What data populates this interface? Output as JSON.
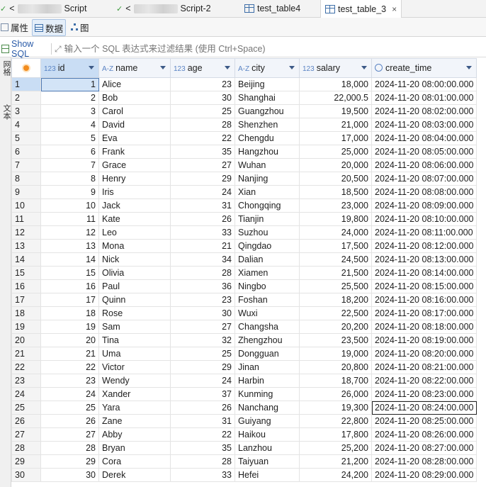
{
  "tabs": [
    {
      "label": "Script",
      "prefix": "<"
    },
    {
      "label": "Script-2",
      "prefix": "<"
    },
    {
      "label": "test_table4"
    },
    {
      "label": "test_table_3",
      "close": "×"
    }
  ],
  "subtabs": [
    "属性",
    "数据",
    "图"
  ],
  "filter": {
    "show_sql": "Show SQL",
    "placeholder": "输入一个 SQL 表达式来过滤结果 (使用 Ctrl+Space)"
  },
  "left_strip": [
    "网格",
    "文本"
  ],
  "columns": [
    {
      "name": "id",
      "type": "123"
    },
    {
      "name": "name",
      "type": "A-Z"
    },
    {
      "name": "age",
      "type": "123"
    },
    {
      "name": "city",
      "type": "A-Z"
    },
    {
      "name": "salary",
      "type": "123"
    },
    {
      "name": "create_time",
      "type": "clock"
    }
  ],
  "rows": [
    [
      "1",
      "1",
      "Alice",
      "23",
      "Beijing",
      "18,000",
      "2024-11-20 08:00:00.000"
    ],
    [
      "2",
      "2",
      "Bob",
      "30",
      "Shanghai",
      "22,000.5",
      "2024-11-20 08:01:00.000"
    ],
    [
      "3",
      "3",
      "Carol",
      "25",
      "Guangzhou",
      "19,500",
      "2024-11-20 08:02:00.000"
    ],
    [
      "4",
      "4",
      "David",
      "28",
      "Shenzhen",
      "21,000",
      "2024-11-20 08:03:00.000"
    ],
    [
      "5",
      "5",
      "Eva",
      "22",
      "Chengdu",
      "17,000",
      "2024-11-20 08:04:00.000"
    ],
    [
      "6",
      "6",
      "Frank",
      "35",
      "Hangzhou",
      "25,000",
      "2024-11-20 08:05:00.000"
    ],
    [
      "7",
      "7",
      "Grace",
      "27",
      "Wuhan",
      "20,000",
      "2024-11-20 08:06:00.000"
    ],
    [
      "8",
      "8",
      "Henry",
      "29",
      "Nanjing",
      "20,500",
      "2024-11-20 08:07:00.000"
    ],
    [
      "9",
      "9",
      "Iris",
      "24",
      "Xian",
      "18,500",
      "2024-11-20 08:08:00.000"
    ],
    [
      "10",
      "10",
      "Jack",
      "31",
      "Chongqing",
      "23,000",
      "2024-11-20 08:09:00.000"
    ],
    [
      "11",
      "11",
      "Kate",
      "26",
      "Tianjin",
      "19,800",
      "2024-11-20 08:10:00.000"
    ],
    [
      "12",
      "12",
      "Leo",
      "33",
      "Suzhou",
      "24,000",
      "2024-11-20 08:11:00.000"
    ],
    [
      "13",
      "13",
      "Mona",
      "21",
      "Qingdao",
      "17,500",
      "2024-11-20 08:12:00.000"
    ],
    [
      "14",
      "14",
      "Nick",
      "34",
      "Dalian",
      "24,500",
      "2024-11-20 08:13:00.000"
    ],
    [
      "15",
      "15",
      "Olivia",
      "28",
      "Xiamen",
      "21,500",
      "2024-11-20 08:14:00.000"
    ],
    [
      "16",
      "16",
      "Paul",
      "36",
      "Ningbo",
      "25,500",
      "2024-11-20 08:15:00.000"
    ],
    [
      "17",
      "17",
      "Quinn",
      "23",
      "Foshan",
      "18,200",
      "2024-11-20 08:16:00.000"
    ],
    [
      "18",
      "18",
      "Rose",
      "30",
      "Wuxi",
      "22,500",
      "2024-11-20 08:17:00.000"
    ],
    [
      "19",
      "19",
      "Sam",
      "27",
      "Changsha",
      "20,200",
      "2024-11-20 08:18:00.000"
    ],
    [
      "20",
      "20",
      "Tina",
      "32",
      "Zhengzhou",
      "23,500",
      "2024-11-20 08:19:00.000"
    ],
    [
      "21",
      "21",
      "Uma",
      "25",
      "Dongguan",
      "19,000",
      "2024-11-20 08:20:00.000"
    ],
    [
      "22",
      "22",
      "Victor",
      "29",
      "Jinan",
      "20,800",
      "2024-11-20 08:21:00.000"
    ],
    [
      "23",
      "23",
      "Wendy",
      "24",
      "Harbin",
      "18,700",
      "2024-11-20 08:22:00.000"
    ],
    [
      "24",
      "24",
      "Xander",
      "37",
      "Kunming",
      "26,000",
      "2024-11-20 08:23:00.000"
    ],
    [
      "25",
      "25",
      "Yara",
      "26",
      "Nanchang",
      "19,300",
      "2024-11-20 08:24:00.000"
    ],
    [
      "26",
      "26",
      "Zane",
      "31",
      "Guiyang",
      "22,800",
      "2024-11-20 08:25:00.000"
    ],
    [
      "27",
      "27",
      "Abby",
      "22",
      "Haikou",
      "17,800",
      "2024-11-20 08:26:00.000"
    ],
    [
      "28",
      "28",
      "Bryan",
      "35",
      "Lanzhou",
      "25,200",
      "2024-11-20 08:27:00.000"
    ],
    [
      "29",
      "29",
      "Cora",
      "28",
      "Taiyuan",
      "21,200",
      "2024-11-20 08:28:00.000"
    ],
    [
      "30",
      "30",
      "Derek",
      "33",
      "Hefei",
      "24,200",
      "2024-11-20 08:29:00.000"
    ]
  ]
}
